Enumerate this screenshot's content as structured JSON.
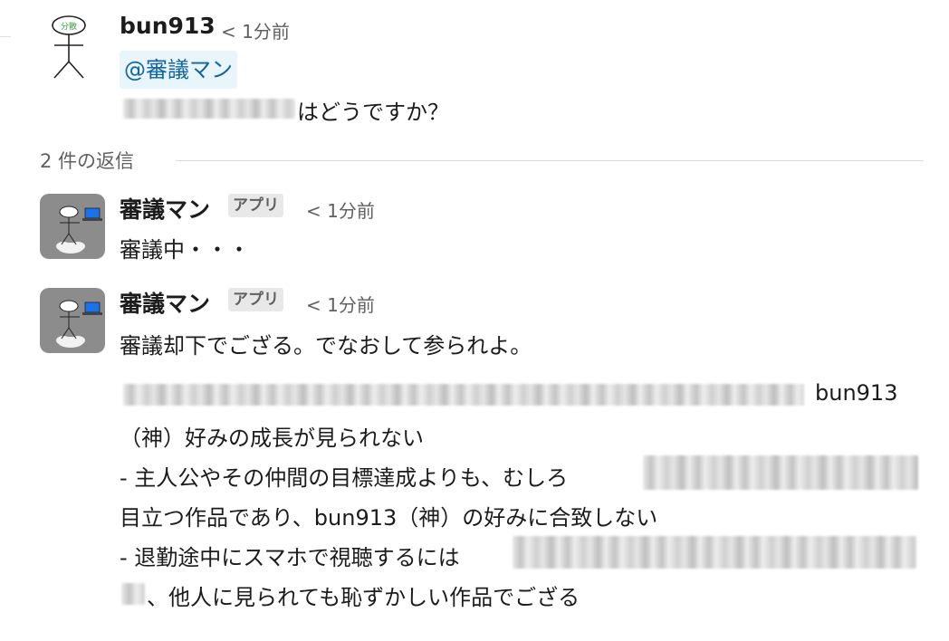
{
  "parent": {
    "author": "bun913",
    "time": "< 1分前",
    "mention": "@審議マン",
    "text_tail": "はどうですか？",
    "avatar_label": "分散"
  },
  "thread": {
    "replies_label": "2 件の返信"
  },
  "replies": [
    {
      "author": "審議マン",
      "badge": "アプリ",
      "time": "< 1分前",
      "lines": [
        "審議中・・・"
      ]
    },
    {
      "author": "審議マン",
      "badge": "アプリ",
      "time": "< 1分前",
      "lines": [
        "審議却下でござる。でなおして参られよ。",
        "bun913",
        "（神）好みの成長が見られない",
        "- 主人公やその仲間の目標達成よりも、むしろ",
        "目立つ作品であり、bun913（神）の好みに合致しない",
        "- 退勤途中にスマホで視聴するには",
        "、他人に見られても恥ずかしい作品でござる"
      ]
    }
  ],
  "colors": {
    "mention_bg": "#e8f5fa",
    "mention_text": "#1264a3",
    "badge_bg": "#e8e8e8",
    "muted": "#616061",
    "app_avatar_bg": "#8c8c8c",
    "screen_blue": "#1a73e8"
  },
  "icons": {
    "parent_avatar": "stick-figure-icon",
    "app_avatar": "stick-figure-laptop-cloud-icon"
  }
}
